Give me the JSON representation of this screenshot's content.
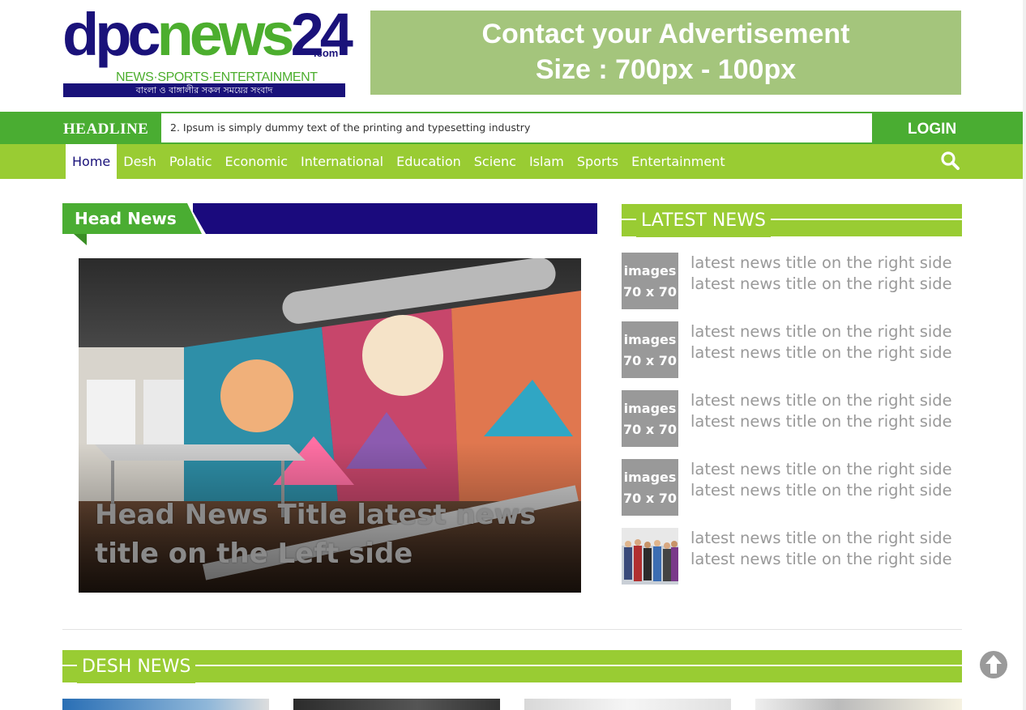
{
  "site": {
    "logo_dpc": "dpc",
    "logo_news": "news",
    "logo_num": "24",
    "logo_com": ".com",
    "logo_tagline": "NEWS·SPORTS·ENTERTAINMENT",
    "logo_bangla": "বাংলা ও বাঙ্গালীর সকল সময়ের সংবাদ"
  },
  "ad": {
    "line1": "Contact your Advertisement",
    "line2": "Size : 700px - 100px"
  },
  "headline": {
    "label": "HEADLINE",
    "ticker": "2. Ipsum is simply dummy text of the printing and typesetting industry",
    "login": "LOGIN"
  },
  "nav": {
    "items": [
      "Home",
      "Desh",
      "Polatic",
      "Economic",
      "International",
      "Education",
      "Scienc",
      "Islam",
      "Sports",
      "Entertainment"
    ],
    "active": "Home"
  },
  "head_news": {
    "label": "Head News",
    "title": "Head News Title latest news title on the Left side"
  },
  "latest": {
    "label": "LATEST NEWS",
    "thumb_line1": "images",
    "thumb_line2": "70 x 70",
    "items": [
      {
        "line1": "latest news title on the right side",
        "line2": "latest news title on the right side"
      },
      {
        "line1": "latest news title on the right side",
        "line2": "latest news title on the right side"
      },
      {
        "line1": "latest news title on the right side",
        "line2": "latest news title on the right side"
      },
      {
        "line1": "latest news title on the right side",
        "line2": "latest news title on the right side"
      },
      {
        "line1": "latest news title on the right side",
        "line2": "latest news title on the right side"
      }
    ]
  },
  "desh": {
    "label": "DESH NEWS"
  },
  "colors": {
    "brand_green": "#4aad32",
    "nav_green": "#99cc33",
    "navy": "#1a0a7d"
  },
  "icons": {
    "search": "search-icon",
    "scroll_top": "arrow-up-circle-icon"
  }
}
